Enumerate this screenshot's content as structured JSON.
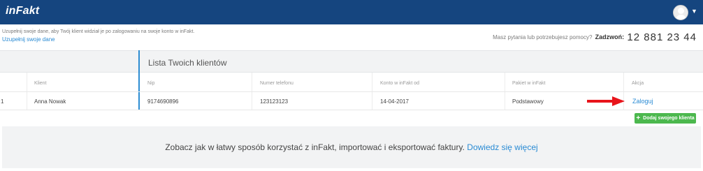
{
  "header": {
    "logo_text": "inFakt",
    "avatar_icon": "user-avatar-icon",
    "menu_icon": "chevron-down-icon"
  },
  "notice": {
    "text": "Uzupełnij swoje dane, aby Twój klient widział je po zalogowaniu na swoje konto w inFakt.",
    "link": "Uzupełnij swoje dane"
  },
  "help": {
    "question": "Masz pytania lub potrzebujesz pomocy?",
    "call_label": "Zadzwoń:",
    "phone": "12 881 23 44"
  },
  "clients": {
    "title": "Lista Twoich klientów",
    "columns": [
      "Klient",
      "Nip",
      "Numer telefonu",
      "Konto w inFakt od",
      "Pakiet w inFakt",
      "Akcja"
    ],
    "rows": [
      {
        "index": "1",
        "client": "Anna Nowak",
        "nip": "9174690896",
        "phone": "123123123",
        "since": "14-04-2017",
        "package": "Podstawowy",
        "action": "Zaloguj"
      }
    ],
    "add_button": "Dodaj swojego klienta",
    "add_icon": "plus-icon",
    "arrow_icon": "red-arrow-icon"
  },
  "promo": {
    "text": "Zobacz jak w łatwy sposób korzystać z inFakt, importować i eksportować faktury.",
    "link": "Dowiedz się więcej"
  },
  "colors": {
    "topbar": "#15457f",
    "accent": "#2d8dd2",
    "link": "#2a8bd4",
    "button": "#4cb84e",
    "arrow": "#e8141b",
    "panel_bg": "#f2f3f4"
  }
}
